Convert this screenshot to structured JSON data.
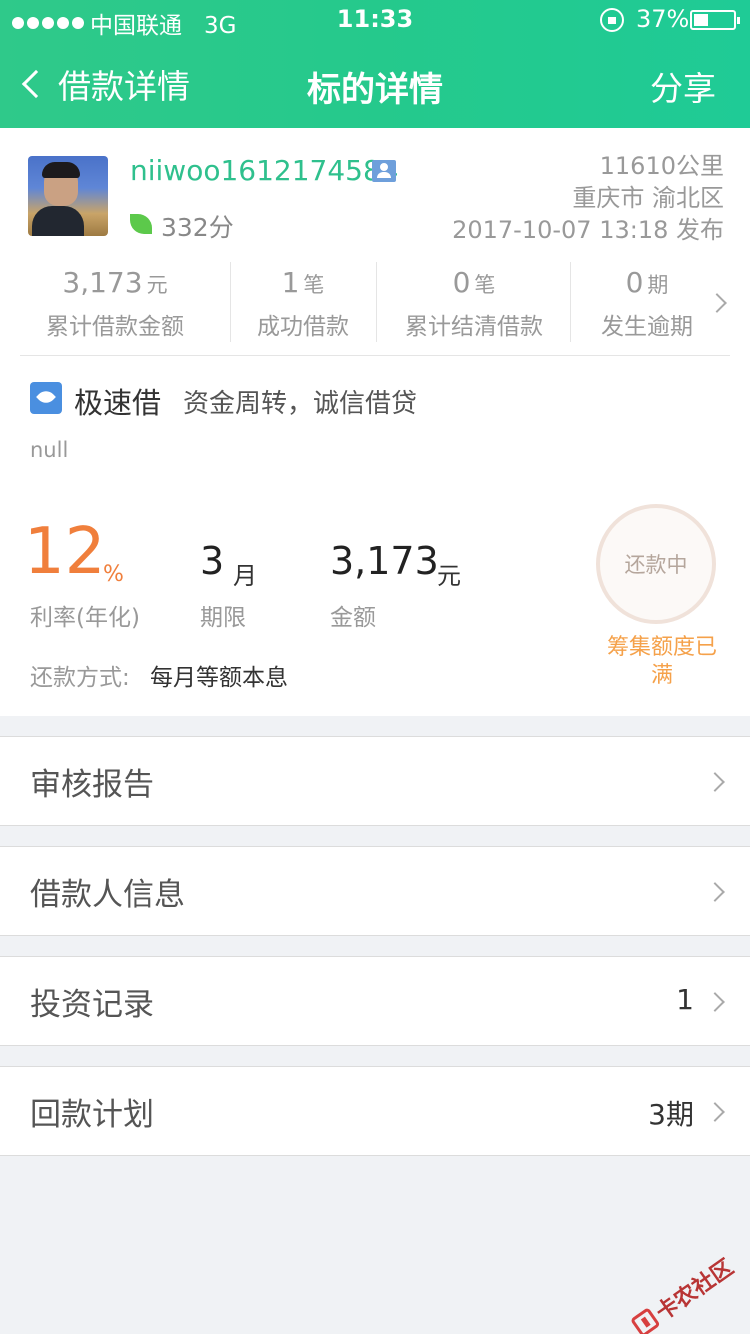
{
  "status_bar": {
    "carrier": "中国联通",
    "network": "3G",
    "time": "11:33",
    "battery_pct": "37%",
    "battery_level": 0.37
  },
  "nav": {
    "back_label": "借款详情",
    "title": "标的详情",
    "share_label": "分享"
  },
  "borrower": {
    "username": "niiwoo1612174584",
    "score": "332分",
    "distance": "11610公里",
    "location": "重庆市 渝北区",
    "published": "2017-10-07 13:18 发布"
  },
  "stats": [
    {
      "value": "3,173",
      "unit": "元",
      "label": "累计借款金额"
    },
    {
      "value": "1",
      "unit": "笔",
      "label": "成功借款"
    },
    {
      "value": "0",
      "unit": "笔",
      "label": "累计结清借款"
    },
    {
      "value": "0",
      "unit": "期",
      "label": "发生逾期"
    }
  ],
  "product": {
    "name": "极速借",
    "desc": "资金周转，诚信借贷",
    "note": "null"
  },
  "loan": {
    "rate": "12",
    "rate_unit": "%",
    "rate_label": "利率(年化)",
    "term": "3",
    "term_unit": "月",
    "term_label": "期限",
    "amount": "3,173",
    "amount_unit": "元",
    "amount_label": "金额",
    "repay_label": "还款方式:",
    "repay_value": "每月等额本息",
    "status": "还款中",
    "status_sub": "筹集额度已满"
  },
  "rows": [
    {
      "label": "审核报告",
      "value": ""
    },
    {
      "label": "借款人信息",
      "value": ""
    },
    {
      "label": "投资记录",
      "value": "1"
    },
    {
      "label": "回款计划",
      "value": "3期"
    }
  ],
  "watermark": "卡农社区",
  "colors": {
    "header": "#2fc98a",
    "rate": "#f07f3c",
    "username": "#2fc08d",
    "status_sub": "#f5a14a"
  }
}
